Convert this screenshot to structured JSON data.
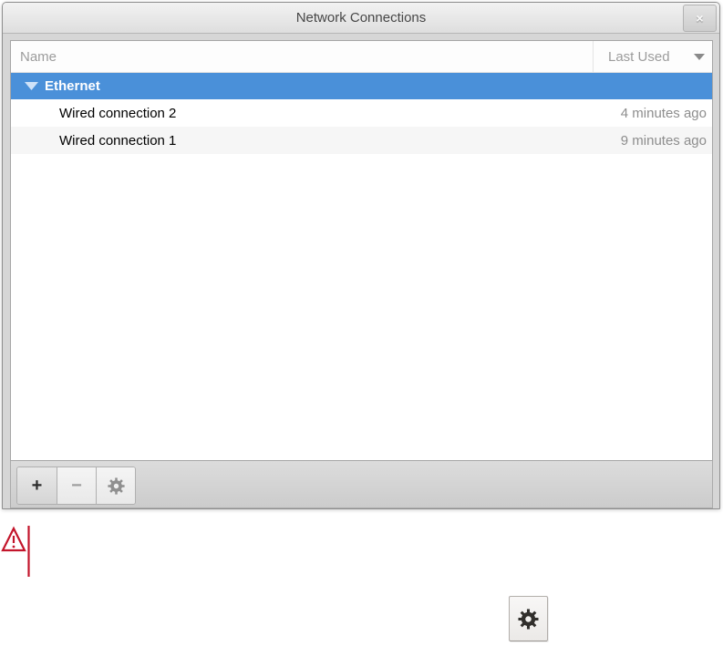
{
  "window": {
    "title": "Network Connections",
    "close_glyph": "×"
  },
  "list": {
    "columns": [
      {
        "label": "Name"
      },
      {
        "label": "Last Used",
        "sort": "descending"
      }
    ],
    "groups": [
      {
        "label": "Ethernet",
        "expanded": true,
        "selected": true,
        "connections": [
          {
            "name": "Wired connection 2",
            "last_used": "4 minutes ago"
          },
          {
            "name": "Wired connection 1",
            "last_used": "9 minutes ago"
          }
        ]
      }
    ]
  },
  "toolbar": {
    "add_glyph": "+",
    "remove_glyph": "−",
    "edit_icon": "gear-icon"
  },
  "annotations": {
    "warning_icon": "warning-triangle-icon",
    "floating_button_icon": "gear-icon"
  },
  "colors": {
    "selection_blue": "#4a90d9",
    "warning_red": "#c3152b",
    "titlebar_gray": "#e8e8e8",
    "muted_text": "#8d8d8d"
  }
}
